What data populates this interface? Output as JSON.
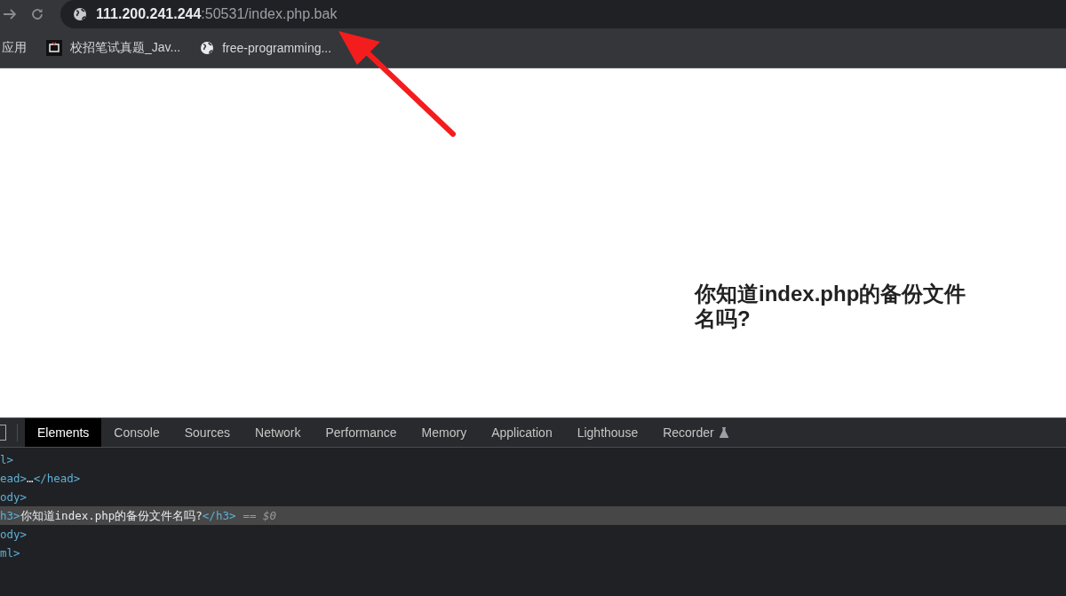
{
  "address_bar": {
    "host": "111.200.241.244",
    "path": ":50531/index.php.bak"
  },
  "bookmarks": [
    {
      "kind": "plain",
      "label": "应用"
    },
    {
      "kind": "app",
      "label": "校招笔试真题_Jav..."
    },
    {
      "kind": "globe",
      "label": "free-programming..."
    }
  ],
  "page": {
    "heading": "你知道index.php的备份文件名吗?"
  },
  "devtools": {
    "tabs": [
      {
        "label": "Elements",
        "selected": true
      },
      {
        "label": "Console",
        "selected": false
      },
      {
        "label": "Sources",
        "selected": false
      },
      {
        "label": "Network",
        "selected": false
      },
      {
        "label": "Performance",
        "selected": false
      },
      {
        "label": "Memory",
        "selected": false
      },
      {
        "label": "Application",
        "selected": false
      },
      {
        "label": "Lighthouse",
        "selected": false
      },
      {
        "label": "Recorder",
        "selected": false,
        "experimental": true
      }
    ],
    "dom_lines": [
      {
        "selected": false,
        "parts": [
          {
            "kind": "tag",
            "text": "l>"
          }
        ]
      },
      {
        "selected": false,
        "parts": [
          {
            "kind": "tag",
            "text": "ead>"
          },
          {
            "kind": "text",
            "text": "…"
          },
          {
            "kind": "tag",
            "text": "</head>"
          }
        ]
      },
      {
        "selected": false,
        "parts": [
          {
            "kind": "tag",
            "text": "ody>"
          }
        ]
      },
      {
        "selected": true,
        "parts": [
          {
            "kind": "tag",
            "text": "h3>"
          },
          {
            "kind": "text",
            "text": "你知道index.php的备份文件名吗?"
          },
          {
            "kind": "tag",
            "text": "</h3>"
          },
          {
            "kind": "meta",
            "text": "== $0"
          }
        ]
      },
      {
        "selected": false,
        "parts": [
          {
            "kind": "tag",
            "text": "ody>"
          }
        ]
      },
      {
        "selected": false,
        "parts": [
          {
            "kind": "tag",
            "text": "ml>"
          }
        ]
      }
    ]
  }
}
